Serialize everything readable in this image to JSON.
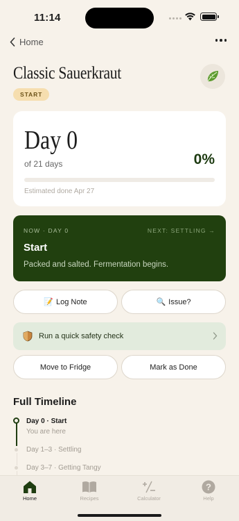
{
  "status": {
    "time": "11:14"
  },
  "nav": {
    "back_label": "Home"
  },
  "batch": {
    "title": "Classic Sauerkraut",
    "stage_badge": "START"
  },
  "progress": {
    "day_label": "Day 0",
    "of_days": "of 21 days",
    "percent": "0%",
    "percent_value": 0,
    "estimate": "Estimated done Apr 27"
  },
  "stage": {
    "now": "NOW · DAY 0",
    "next": "NEXT: SETTLING →",
    "name": "Start",
    "description": "Packed and salted. Fermentation begins."
  },
  "actions": {
    "log_note": "Log Note",
    "log_note_emoji": "📝",
    "issue": "Issue?",
    "issue_emoji": "🔍",
    "safety": "Run a quick safety check",
    "move_fridge": "Move to Fridge",
    "mark_done": "Mark as Done"
  },
  "timeline": {
    "heading": "Full Timeline",
    "items": [
      {
        "title": "Day 0 · Start",
        "sub": "You are here"
      },
      {
        "title": "Day 1–3 · Settling"
      },
      {
        "title": "Day 3–7 · Getting Tangy"
      }
    ]
  },
  "tabs": [
    {
      "label": "Home",
      "icon": "home-icon",
      "active": true
    },
    {
      "label": "Recipes",
      "icon": "book-icon"
    },
    {
      "label": "Calculator",
      "icon": "plus-minus-icon"
    },
    {
      "label": "Help",
      "icon": "question-icon"
    }
  ],
  "colors": {
    "accent": "#21400f",
    "background": "#f7f2ea",
    "badge": "#f6deaf",
    "safety_bg": "#e2ebdd"
  }
}
